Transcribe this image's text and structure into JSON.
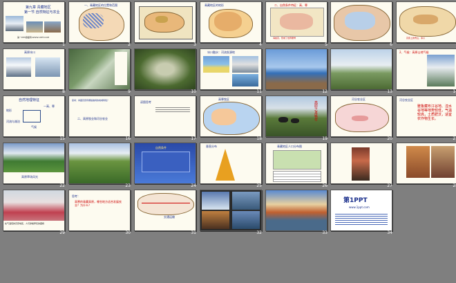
{
  "colors": {
    "background": "#7f7f7f",
    "slide": "#fdfbf0",
    "accent": "#c00000",
    "title_blue": "#1a2f8c"
  },
  "slides": [
    {
      "num": "1",
      "title": "第九章 青藏地区",
      "subtitle": "第一节 自然特征与农业",
      "footer": "第一PPT模板网-WWW.1PPT.COM"
    },
    {
      "num": "2",
      "title": "一、青藏地区的位置和范围"
    },
    {
      "num": "3",
      "title": ""
    },
    {
      "num": "4",
      "title": "青藏地区的地形"
    },
    {
      "num": "5",
      "title": "二、自然条件特征：高、寒",
      "note": "海拔高，形成了世界屋脊"
    },
    {
      "num": "6",
      "title": ""
    },
    {
      "num": "7",
      "title": "",
      "note": "高原上的雪山、冰川"
    },
    {
      "num": "8",
      "title": "高原冰川"
    },
    {
      "num": "9",
      "title": ""
    },
    {
      "num": "10",
      "title": ""
    },
    {
      "num": "11",
      "title": "冰川融水：河流发源地"
    },
    {
      "num": "12",
      "title": ""
    },
    {
      "num": "13",
      "title": ""
    },
    {
      "num": "14",
      "title": "2、气候：高原山地气候"
    },
    {
      "num": "15",
      "title": "自然地理特征",
      "side": "一高、寒",
      "items": [
        "地形",
        "气候",
        "河流与湖泊",
        "土壤"
      ]
    },
    {
      "num": "16",
      "title": "思考：青藏高原有哪些独特的地域特色？",
      "subtitle": "二、高原牧业和河谷农业"
    },
    {
      "num": "17",
      "title": "读图思考"
    },
    {
      "num": "18",
      "title": "高寒牧区"
    },
    {
      "num": "19",
      "title": "",
      "vertical": "高原之舟 牦牛"
    },
    {
      "num": "20",
      "title": "河谷农业区"
    },
    {
      "num": "21",
      "title": "河谷农业区",
      "body": "雅鲁藏布江谷地、湟水谷地等地势较低，气温较高，土质肥沃，适宜农作物生长。"
    },
    {
      "num": "22",
      "title": "",
      "caption": "高原草场风光"
    },
    {
      "num": "23",
      "title": ""
    },
    {
      "num": "24",
      "title": "自然条件"
    },
    {
      "num": "25",
      "title": "垂直分布"
    },
    {
      "num": "26",
      "title": "青藏地区人口分布图"
    },
    {
      "num": "27",
      "title": "第三节 人口民族"
    },
    {
      "num": "28",
      "title": ""
    },
    {
      "num": "29",
      "title": "",
      "caption": "在气温低的高原地区，人们穿着厚实的藏袍"
    },
    {
      "num": "30",
      "title": "思考：",
      "body": "高寒的青藏高原，哪些地方适合发展农业？为什么？"
    },
    {
      "num": "31",
      "title": "交通运输"
    },
    {
      "num": "32",
      "title": ""
    },
    {
      "num": "33",
      "title": ""
    },
    {
      "num": "34",
      "title": "第1PPT",
      "subtitle": "www.1ppt.com"
    }
  ]
}
